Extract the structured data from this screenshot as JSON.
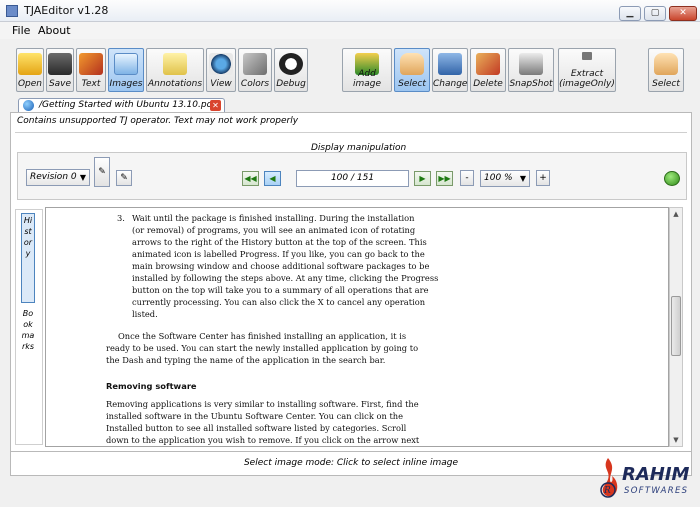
{
  "window": {
    "title": "TJAEditor v1.28"
  },
  "menu": {
    "file": "File",
    "about": "About"
  },
  "toolbar": {
    "open": "Open",
    "save": "Save",
    "text": "Text",
    "images": "Images",
    "annotations": "Annotations",
    "view": "View",
    "colors": "Colors",
    "debug": "Debug",
    "add_image": "Add image",
    "select": "Select",
    "change": "Change",
    "delete": "Delete",
    "snapshot": "SnapShot",
    "extract": "Extract\n(imageOnly)",
    "select2": "Select"
  },
  "tab": {
    "name": "/Getting Started with Ubuntu 13.10.pdf"
  },
  "warning": "Contains unsupported TJ operator. Text may not work properly",
  "display": {
    "label": "Display manipulation",
    "revision": "Revision 0",
    "page": "100 / 151",
    "zoom": "100 %",
    "minus": "-",
    "plus": "+"
  },
  "sidebar": {
    "history": "History",
    "bookmarks": "Bookmarks"
  },
  "document": {
    "item_number": "3.",
    "item_lines": [
      "Wait until the package is finished installing. During the installation",
      "(or removal) of programs, you will see an animated icon of rotating",
      "arrows to the right of the History button at the top of the screen. This",
      "animated icon is labelled Progress. If you like, you can go back to the",
      "main browsing window and choose additional software packages to be",
      "installed by following the steps above. At any time, clicking the Progress",
      "button on the top will take you to a summary of all operations that are",
      "currently processing. You can also click the X to cancel any operation",
      "listed."
    ],
    "para_lines": [
      "Once the Software Center has finished installing an application, it is",
      "ready to be used. You can start the newly installed application by going to",
      "the Dash and typing the name of the application in the search bar."
    ],
    "heading": "Removing software",
    "para2_lines": [
      "Removing applications is very similar to installing software. First, find the",
      "installed software in the Ubuntu Software Center. You can click on the",
      "Installed button to see all installed software listed by categories. Scroll",
      "down to the application you wish to remove. If you click on the arrow next"
    ]
  },
  "status": "Select image mode: Click to select inline image",
  "watermark": {
    "brand": "RAHIM",
    "sub": "SOFTWARES"
  }
}
